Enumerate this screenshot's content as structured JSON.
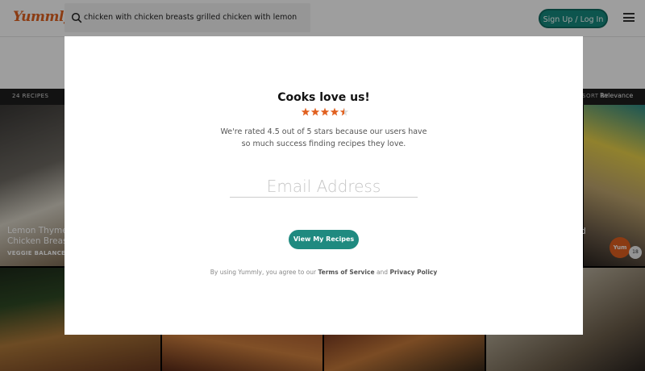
{
  "header": {
    "logo": "Yummly",
    "search_value": "chicken with chicken breasts grilled chicken with lemon",
    "signup_label": "Sign Up / Log In",
    "brand_color": "#e16120",
    "accent_color": "#168a7e"
  },
  "results_bar": {
    "recipe_count": "24 RECIPES",
    "sort_label": "SORT BY",
    "sort_value": "Relevance"
  },
  "tiles": {
    "first": {
      "title_line1": "Lemon Thyme",
      "title_line2": "Chicken Breast",
      "source": "VEGGIE BALANCE"
    },
    "right_title_fragment": "d",
    "yum_label": "Yum",
    "yum_count": "18"
  },
  "modal": {
    "title": "Cooks love us!",
    "rating": 4.5,
    "rating_max": 5,
    "star_color": "#e16120",
    "description_line1": "We're rated 4.5 out of 5 stars because our users have",
    "description_line2": "so much success finding recipes they love.",
    "email_placeholder": "Email Address",
    "cta_label": "View My Recipes",
    "terms_prefix": "By using Yummly, you agree to our",
    "terms_link": "Terms of Service",
    "terms_and": "and",
    "privacy_link": "Privacy Policy"
  }
}
